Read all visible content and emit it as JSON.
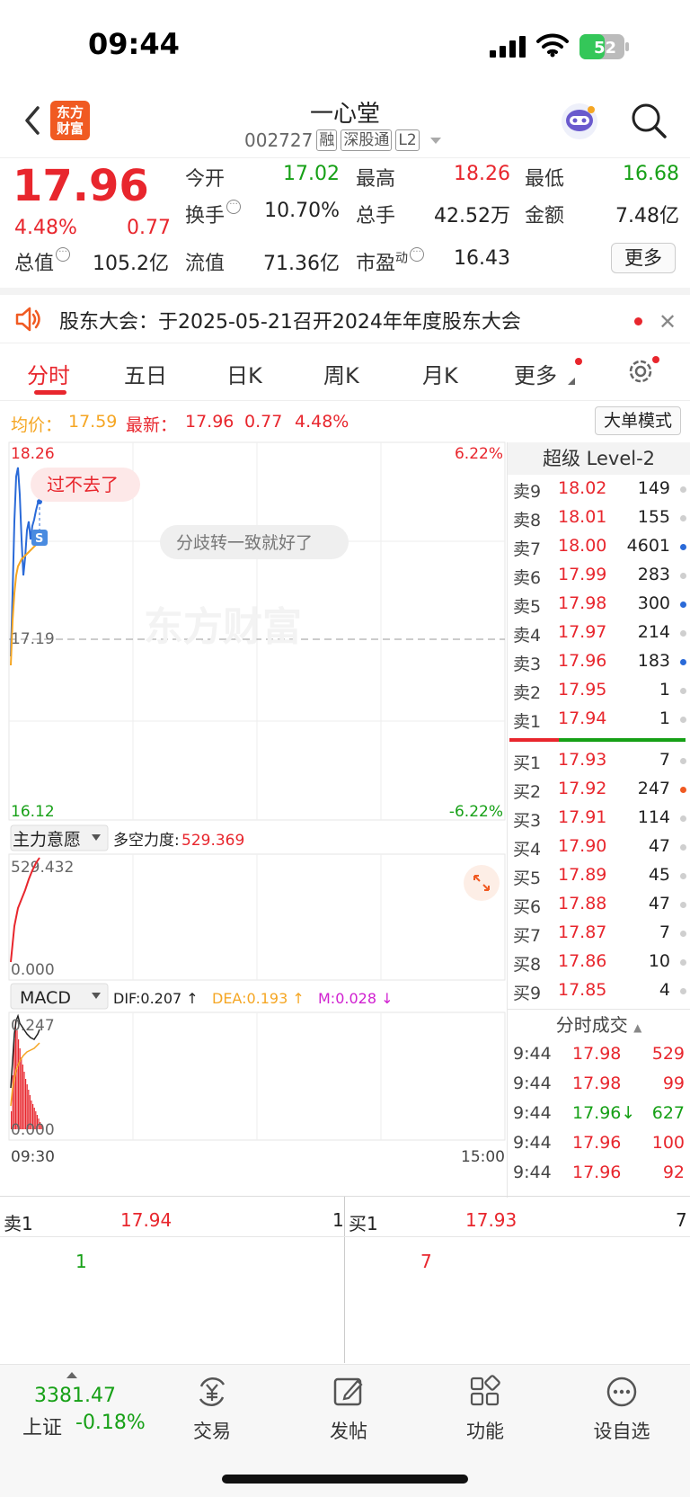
{
  "status": {
    "time": "09:44",
    "battery": "52"
  },
  "header": {
    "logo_line1": "东方",
    "logo_line2": "财富",
    "name": "一心堂",
    "code": "002727",
    "tags": [
      "融",
      "深股通",
      "L2"
    ]
  },
  "quote": {
    "price": "17.96",
    "change_pct": "4.48%",
    "change_amt": "0.77",
    "open_label": "今开",
    "open": "17.02",
    "high_label": "最高",
    "high": "18.26",
    "low_label": "最低",
    "low": "16.68",
    "turnover_label": "换手",
    "turnover": "10.70%",
    "volume_label": "总手",
    "volume": "42.52万",
    "amount_label": "金额",
    "amount": "7.48亿",
    "mktcap_label": "总值",
    "mktcap": "105.2亿",
    "float_label": "流值",
    "float": "71.36亿",
    "pe_label": "市盈",
    "pe_super": "动",
    "pe": "16.43",
    "more_label": "更多"
  },
  "notice": {
    "text": "股东大会：于2025-05-21召开2024年年度股东大会"
  },
  "tabs": [
    {
      "label": "分时",
      "active": true
    },
    {
      "label": "五日"
    },
    {
      "label": "日K"
    },
    {
      "label": "周K"
    },
    {
      "label": "月K"
    },
    {
      "label": "更多"
    }
  ],
  "avg_line": {
    "avg_label": "均价：",
    "avg": "17.59",
    "latest_label": "最新：",
    "latest": "17.96",
    "chg": "0.77",
    "pct": "4.48%",
    "big_order_label": "大单模式"
  },
  "chart": {
    "price_top": "18.26",
    "price_mid": "17.19",
    "price_bottom": "16.12",
    "pct_top": "6.22%",
    "pct_bottom": "-6.22%",
    "bubble1": "过不去了",
    "bubble2": "分歧转一致就好了",
    "watermark": "东方财富",
    "s_marker": "S",
    "indicator_name": "主力意愿",
    "indicator_label": "多空力度:",
    "indicator_value": "529.369",
    "indicator_top": "529.432",
    "indicator_zero": "0.000",
    "macd_name": "MACD",
    "dif": "DIF:0.207 ↑",
    "dea": "DEA:0.193 ↑",
    "m": "M:0.028 ↓",
    "macd_top": "0.247",
    "macd_zero": "0.000",
    "time_start": "09:30",
    "time_end": "15:00"
  },
  "level2_title": "超级 Level-2",
  "asks": [
    {
      "label": "卖9",
      "price": "18.02",
      "vol": "149",
      "dot": "gray"
    },
    {
      "label": "卖8",
      "price": "18.01",
      "vol": "155",
      "dot": "gray"
    },
    {
      "label": "卖7",
      "price": "18.00",
      "vol": "4601",
      "dot": "blue"
    },
    {
      "label": "卖6",
      "price": "17.99",
      "vol": "283",
      "dot": "gray"
    },
    {
      "label": "卖5",
      "price": "17.98",
      "vol": "300",
      "dot": "blue"
    },
    {
      "label": "卖4",
      "price": "17.97",
      "vol": "214",
      "dot": "gray"
    },
    {
      "label": "卖3",
      "price": "17.96",
      "vol": "183",
      "dot": "blue"
    },
    {
      "label": "卖2",
      "price": "17.95",
      "vol": "1",
      "dot": "gray"
    },
    {
      "label": "卖1",
      "price": "17.94",
      "vol": "1",
      "dot": "gray"
    }
  ],
  "bids": [
    {
      "label": "买1",
      "price": "17.93",
      "vol": "7",
      "dot": "gray"
    },
    {
      "label": "买2",
      "price": "17.92",
      "vol": "247",
      "dot": "orange"
    },
    {
      "label": "买3",
      "price": "17.91",
      "vol": "114",
      "dot": "gray"
    },
    {
      "label": "买4",
      "price": "17.90",
      "vol": "47",
      "dot": "gray"
    },
    {
      "label": "买5",
      "price": "17.89",
      "vol": "45",
      "dot": "gray"
    },
    {
      "label": "买6",
      "price": "17.88",
      "vol": "47",
      "dot": "gray"
    },
    {
      "label": "买7",
      "price": "17.87",
      "vol": "7",
      "dot": "gray"
    },
    {
      "label": "买8",
      "price": "17.86",
      "vol": "10",
      "dot": "gray"
    },
    {
      "label": "买9",
      "price": "17.85",
      "vol": "4",
      "dot": "gray"
    }
  ],
  "trades_title": "分时成交",
  "trades": [
    {
      "time": "9:44",
      "price": "17.98",
      "vol": "529",
      "color": "red"
    },
    {
      "time": "9:44",
      "price": "17.98",
      "vol": "99",
      "color": "red"
    },
    {
      "time": "9:44",
      "price": "17.96↓",
      "vol": "627",
      "color": "green"
    },
    {
      "time": "9:44",
      "price": "17.96",
      "vol": "100",
      "color": "red"
    },
    {
      "time": "9:44",
      "price": "17.96",
      "vol": "92",
      "color": "red"
    }
  ],
  "bottom_quotes": {
    "ask_label": "卖1",
    "ask_price": "17.94",
    "ask_vol": "1",
    "ask_detail": "1",
    "bid_label": "买1",
    "bid_price": "17.93",
    "bid_vol": "7",
    "bid_detail": "7"
  },
  "toolbar": {
    "index_value": "3381.47",
    "index_name": "上证",
    "index_chg": "-0.18%",
    "trade": "交易",
    "post": "发帖",
    "functions": "功能",
    "watchlist": "设自选"
  },
  "colors": {
    "up": "#e8262d",
    "down": "#16a016",
    "avg": "#f5a623",
    "accent": "#f05a22"
  }
}
